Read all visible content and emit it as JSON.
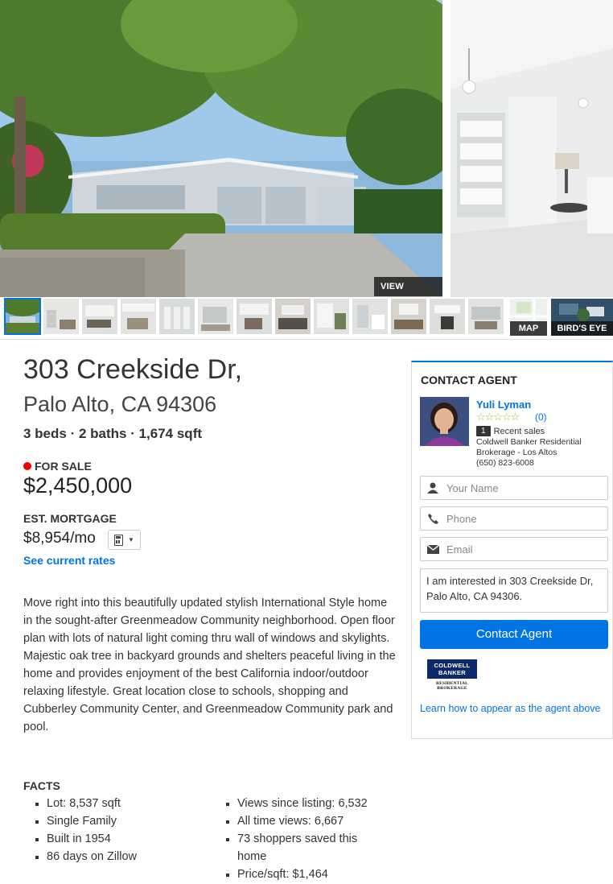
{
  "gallery": {
    "view_larger": "VIEW LARGER",
    "map_label": "MAP",
    "birds_eye_label": "BIRD'S EYE",
    "thumbnail_count": 13,
    "selected_thumbnail": 1
  },
  "listing": {
    "street": "303 Creekside Dr,",
    "city_state_zip": "Palo Alto, CA 94306",
    "specs": "3 beds · 2 baths · 1,674 sqft",
    "status": "FOR SALE",
    "status_color": "#e00000",
    "price": "$2,450,000",
    "mortgage_label": "EST. MORTGAGE",
    "mortgage_value": "$8,954/mo",
    "rates_link": "See current rates",
    "description": "Move right into this beautifully updated stylish International Style home in the sought-after Greenmeadow Community neighborhood. Open floor plan with lots of natural light coming thru wall of windows and skylights. Majestic oak tree in backyard grounds and shelters peaceful living in the home and provides enjoyment of the best California indoor/outdoor relaxing lifestyle. Great location close to schools, shopping and Cubberley Community Center, and Greenmeadow Community park and pool."
  },
  "facts": {
    "label": "FACTS",
    "left": [
      "Lot: 8,537 sqft",
      "Single Family",
      "Built in 1954",
      "86 days on Zillow"
    ],
    "right": [
      "Views since listing: 6,532",
      "All time views: 6,667",
      "73 shoppers saved this home",
      "Price/sqft: $1,464"
    ]
  },
  "contact": {
    "title": "CONTACT AGENT",
    "agent_name": "Yuli Lyman",
    "stars": "☆☆☆☆☆",
    "review_count": "(0)",
    "recent_sales_count": "1",
    "recent_sales_label": "Recent sales",
    "brokerage": "Coldwell Banker Residential Brokerage - Los Altos",
    "phone": "(650) 823-6008",
    "name_placeholder": "Your Name",
    "phone_placeholder": "Phone",
    "email_placeholder": "Email",
    "message": "I am interested in 303 Creekside Dr, Palo Alto, CA 94306.",
    "button": "Contact Agent",
    "logo_line1": "COLDWELL",
    "logo_line2": "BANKER",
    "logo_sub": "RESIDENTIAL BROKERAGE",
    "learn_link": "Learn how to appear as the agent above",
    "accent_color": "#0074e4"
  }
}
